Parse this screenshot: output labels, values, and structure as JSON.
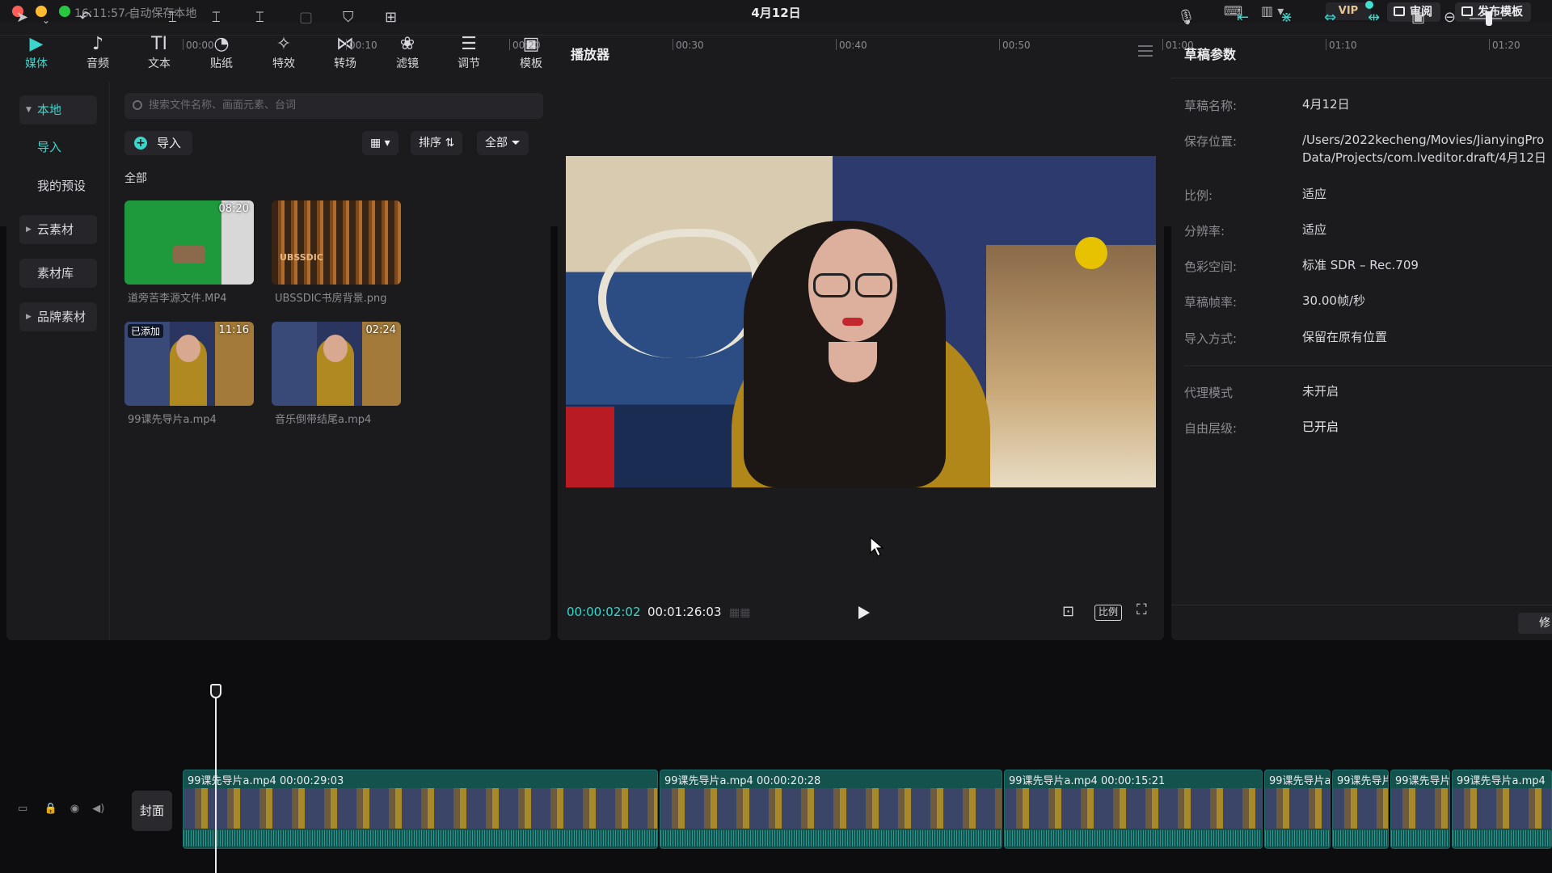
{
  "titlebar": {
    "autosave": "16:11:57 自动保存本地",
    "title": "4月12日",
    "vip": "VIP",
    "review": "审阅",
    "publish": "发布模板"
  },
  "categories": [
    {
      "label": "媒体",
      "icon": "media-icon",
      "glyph": "▶",
      "active": true
    },
    {
      "label": "音频",
      "icon": "audio-icon",
      "glyph": "♪",
      "active": false
    },
    {
      "label": "文本",
      "icon": "text-icon",
      "glyph": "TI",
      "active": false
    },
    {
      "label": "贴纸",
      "icon": "sticker-icon",
      "glyph": "◔",
      "active": false
    },
    {
      "label": "特效",
      "icon": "effects-icon",
      "glyph": "✧",
      "active": false
    },
    {
      "label": "转场",
      "icon": "transition-icon",
      "glyph": "⋈",
      "active": false
    },
    {
      "label": "滤镜",
      "icon": "filter-icon",
      "glyph": "❀",
      "active": false
    },
    {
      "label": "调节",
      "icon": "adjust-icon",
      "glyph": "☰",
      "active": false
    },
    {
      "label": "模板",
      "icon": "template-icon",
      "glyph": "▣",
      "active": false
    }
  ],
  "sidenav": {
    "local": "本地",
    "import": "导入",
    "presets": "我的预设",
    "cloud": "云素材",
    "library": "素材库",
    "brand": "品牌素材"
  },
  "media": {
    "search_placeholder": "搜索文件名称、画面元素、台词",
    "import_label": "导入",
    "sort_label": "排序",
    "filter_label": "全部",
    "section": "全部",
    "items": [
      {
        "name": "道旁苦李源文件.MP4",
        "duration": "08:20",
        "added": ""
      },
      {
        "name": "UBSSDIC书房背景.png",
        "duration": "",
        "added": ""
      },
      {
        "name": "99课先导片a.mp4",
        "duration": "11:16",
        "added": "已添加"
      },
      {
        "name": "音乐倒带结尾a.mp4",
        "duration": "02:24",
        "added": ""
      }
    ]
  },
  "player": {
    "title": "播放器",
    "current_time": "00:00:02:02",
    "total_time": "00:01:26:03",
    "ratio_label": "比例"
  },
  "props": {
    "title": "草稿参数",
    "rows": [
      {
        "label": "草稿名称:",
        "value": "4月12日"
      },
      {
        "label": "保存位置:",
        "value": "/Users/2022kecheng/Movies/JianyingPro",
        "value2": "Data/Projects/com.lveditor.draft/4月12日"
      },
      {
        "label": "比例:",
        "value": "适应"
      },
      {
        "label": "分辨率:",
        "value": "适应"
      },
      {
        "label": "色彩空间:",
        "value": "标准 SDR – Rec.709"
      },
      {
        "label": "草稿帧率:",
        "value": "30.00帧/秒"
      },
      {
        "label": "导入方式:",
        "value": "保留在原有位置"
      },
      {
        "label": "代理模式",
        "value": "未开启"
      },
      {
        "label": "自由层级:",
        "value": "已开启"
      }
    ],
    "edit_label": "修"
  },
  "timeline": {
    "ticks": [
      "00:00",
      "00:10",
      "00:20",
      "00:30",
      "00:40",
      "00:50",
      "01:00",
      "01:10",
      "01:20"
    ],
    "cover": "封面",
    "clips": [
      {
        "label": "99课先导片a.mp4   00:00:29:03"
      },
      {
        "label": "99课先导片a.mp4   00:00:20:28"
      },
      {
        "label": "99课先导片a.mp4   00:00:15:21"
      },
      {
        "label": "99课先导片a"
      },
      {
        "label": "99课先导片"
      },
      {
        "label": "99课先导片"
      },
      {
        "label": "99课先导片a.mp4"
      }
    ]
  },
  "colors": {
    "accent": "#3ad6cc",
    "panel": "#1b1b1e",
    "background": "#0d0d0f"
  }
}
